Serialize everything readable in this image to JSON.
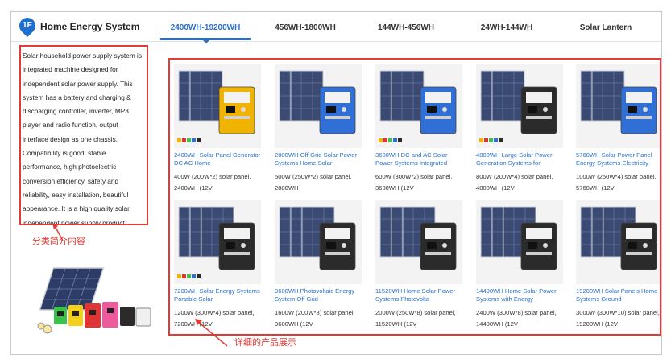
{
  "header": {
    "floor_badge": "1F",
    "title": "Home Energy System",
    "tabs": [
      {
        "label": "2400WH-19200WH",
        "active": true
      },
      {
        "label": "456WH-1800WH",
        "active": false
      },
      {
        "label": "144WH-456WH",
        "active": false
      },
      {
        "label": "24WH-144WH",
        "active": false
      },
      {
        "label": "Solar Lantern",
        "active": false
      }
    ]
  },
  "intro": {
    "text": "Solar household power supply system is integrated machine designed for independent solar power supply. This system has a battery and charging & discharging controller, inverter, MP3 player and radio function, output interface design as one chassis. Compatibility is good, stable performance, high photoelectric conversion efficiency, safety and reliability, easy installation, beautiful appearance. It is a high quality solar independent power supply product."
  },
  "annotations": {
    "intro_note": "分类简介内容",
    "products_note": "详细的产品展示"
  },
  "colors": {
    "accent_blue": "#2a6fc9",
    "annotation_red": "#e53935"
  },
  "products": [
    {
      "title": "2400WH Solar Panel Generator DC AC Home",
      "desc": "400W (200W*2) solar panel, 2400WH (12V",
      "unit_color": "#f0b400",
      "swatch_label": "Color options"
    },
    {
      "title": "2800WH Off-Grid Solar Power Systems Home Solar",
      "desc": "500W (250W*2) solar panel, 2880WH",
      "unit_color": "#2f6fd6",
      "swatch_label": ""
    },
    {
      "title": "3600WH DC and AC Solar Power Systems Integrated",
      "desc": "600W (300W*2) solar panel, 3600WH (12V",
      "unit_color": "#2f6fd6",
      "swatch_label": "Color options"
    },
    {
      "title": "4800WH Large Solar Power Generation Systems for",
      "desc": "800W (200W*4) solar panel, 4800WH (12V",
      "unit_color": "#2b2b2b",
      "swatch_label": "Color options"
    },
    {
      "title": "5760WH Solar Power Panel Energy Systems Electricity",
      "desc": "1000W (250W*4) solar panel, 5760WH (12V",
      "unit_color": "#2f6fd6",
      "swatch_label": ""
    },
    {
      "title": "7200WH Solar Energy Systems Portable Solar",
      "desc": "1200W (300W*4) solar panel, 7200WH (12V",
      "unit_color": "#2b2b2b",
      "swatch_label": "Color options"
    },
    {
      "title": "9600WH Photovoltaic Energy System Off Grid",
      "desc": "1600W (200W*8) solar panel, 9600WH (12V",
      "unit_color": "#2b2b2b",
      "swatch_label": ""
    },
    {
      "title": "11520WH Home Solar Power Systems Photovolta",
      "desc": "2000W (250W*8) solar panel, 11520WH (12V",
      "unit_color": "#2b2b2b",
      "swatch_label": ""
    },
    {
      "title": "14400WH Home Solar Power Systems with Energy",
      "desc": "2400W (300W*8) solar panel, 14400WH (12V",
      "unit_color": "#2b2b2b",
      "swatch_label": ""
    },
    {
      "title": "19200WH Solar Panels Home Systems Ground",
      "desc": "3000W (300W*10) solar panel, 19200WH (12V",
      "unit_color": "#2b2b2b",
      "swatch_label": ""
    }
  ]
}
